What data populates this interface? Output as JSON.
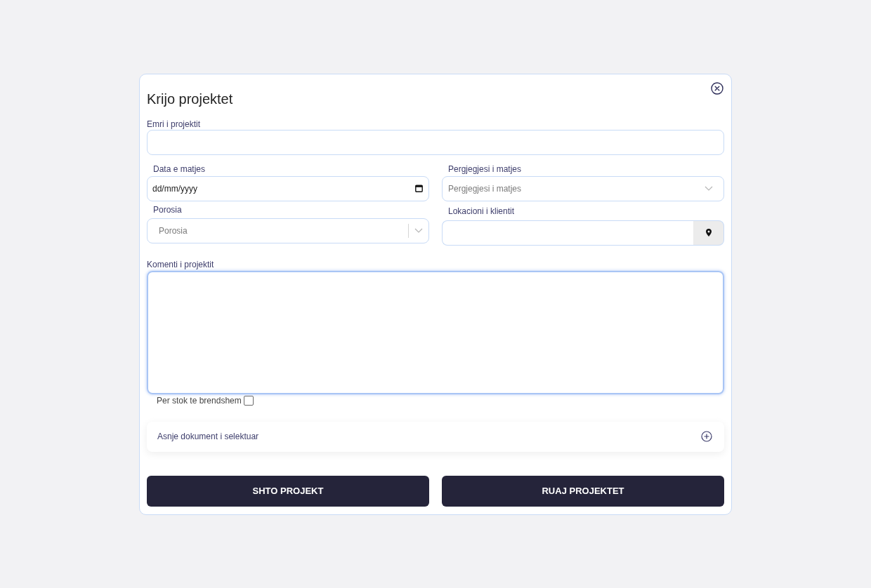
{
  "dialog": {
    "title": "Krijo projektet"
  },
  "project_name": {
    "label": "Emri i projektit"
  },
  "measure_date": {
    "label": "Data e matjes",
    "placeholder": "dd/mm/yyyy"
  },
  "responsible": {
    "label": "Pergjegjesi i matjes",
    "placeholder": "Pergjegjesi i matjes"
  },
  "order": {
    "label": "Porosia",
    "placeholder": "Porosia"
  },
  "client_location": {
    "label": "Lokacioni i klientit"
  },
  "comment": {
    "label": "Komenti i projektit",
    "focused": true
  },
  "internal_stock": {
    "label": "Per stok te brendshem",
    "checked": false
  },
  "documents": {
    "text": "Asnje dokument i selektuar"
  },
  "buttons": [
    {
      "label": "SHTO PROJEKT"
    },
    {
      "label": "RUAJ PROJEKTET"
    }
  ]
}
